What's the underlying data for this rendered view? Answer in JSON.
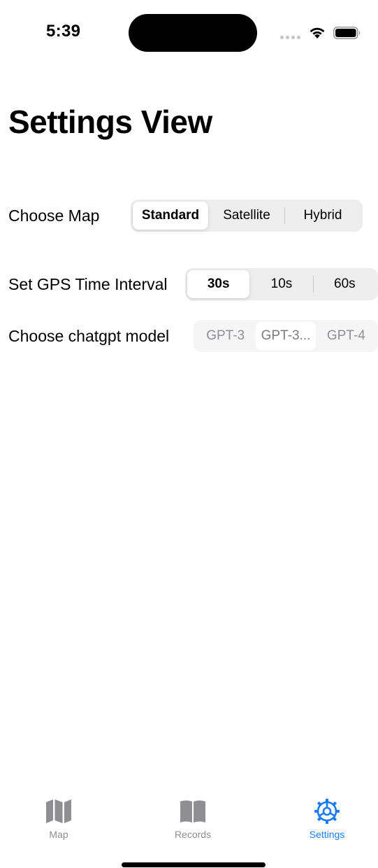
{
  "status_bar": {
    "time": "5:39"
  },
  "page": {
    "title": "Settings View"
  },
  "settings": {
    "map": {
      "label": "Choose Map",
      "options": [
        "Standard",
        "Satellite",
        "Hybrid"
      ],
      "selected": "Standard"
    },
    "gps_interval": {
      "label": "Set GPS Time Interval",
      "options": [
        "30s",
        "10s",
        "60s"
      ],
      "selected": "30s"
    },
    "chatgpt_model": {
      "label": "Choose chatgpt model",
      "options": [
        "GPT-3",
        "GPT-3...",
        "GPT-4"
      ],
      "selected": "GPT-3...",
      "enabled": false
    }
  },
  "tabbar": {
    "tabs": [
      {
        "label": "Map",
        "icon": "map-icon",
        "active": false
      },
      {
        "label": "Records",
        "icon": "book-icon",
        "active": false
      },
      {
        "label": "Settings",
        "icon": "gear-icon",
        "active": true
      }
    ]
  },
  "colors": {
    "accent": "#1a7cf5",
    "inactive": "#8e8e93",
    "segment_bg": "#eeeeef"
  }
}
